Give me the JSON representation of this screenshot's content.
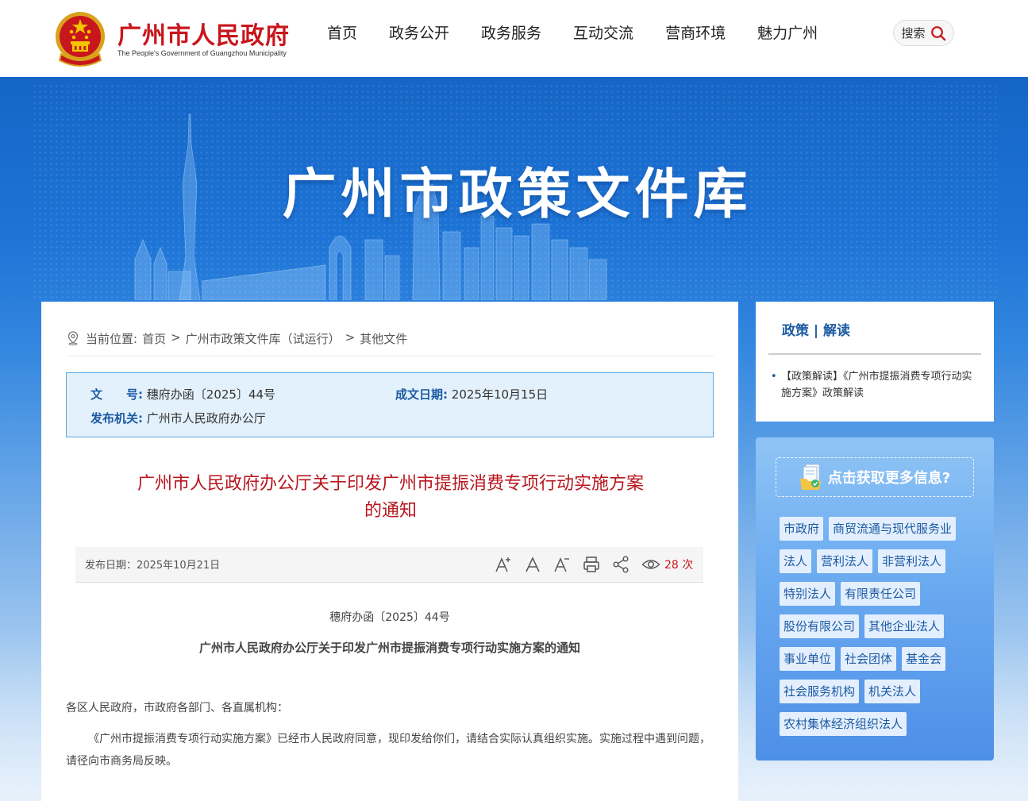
{
  "header": {
    "site_title": "广州市人民政府",
    "site_subtitle": "The People's Government of Guangzhou Municipality",
    "nav": [
      "首页",
      "政务公开",
      "政务服务",
      "互动交流",
      "营商环境",
      "魅力广州"
    ],
    "search_label": "搜索"
  },
  "banner": {
    "title": "广州市政策文件库"
  },
  "breadcrumb": {
    "prefix": "当前位置:",
    "items": [
      "首页",
      "广州市政策文件库（试运行）",
      "其他文件"
    ],
    "separator": ">"
  },
  "meta": {
    "doc_no_label": "文　　号:",
    "doc_no_value": "穗府办函〔2025〕44号",
    "date_label": "成文日期:",
    "date_value": "2025年10月15日",
    "issuer_label": "发布机关:",
    "issuer_value": "广州市人民政府办公厅"
  },
  "document": {
    "title_line1": "广州市人民政府办公厅关于印发广州市提振消费专项行动实施方案",
    "title_line2": "的通知",
    "publish_date": "发布日期：2025年10月21日",
    "views_count": "28",
    "views_unit": "次",
    "doc_number": "穗府办函〔2025〕44号",
    "subtitle": "广州市人民政府办公厅关于印发广州市提振消费专项行动实施方案的通知",
    "salutation": "各区人民政府，市政府各部门、各直属机构：",
    "body": "《广州市提振消费专项行动实施方案》已经市人民政府同意，现印发给你们，请结合实际认真组织实施。实施过程中遇到问题，请径向市商务局反映。"
  },
  "toolbar_icons": [
    "font-increase-icon",
    "font-reset-icon",
    "font-decrease-icon",
    "print-icon",
    "share-icon",
    "eye-icon"
  ],
  "sidebar": {
    "heading": "政策 | 解读",
    "items": [
      "【政策解读】《广州市提振消费专项行动实施方案》政策解读"
    ]
  },
  "tag_panel": {
    "header": "点击获取更多信息?",
    "tags": [
      "市政府",
      "商贸流通与现代服务业",
      "法人",
      "营利法人",
      "非营利法人",
      "特别法人",
      "有限责任公司",
      "股份有限公司",
      "其他企业法人",
      "事业单位",
      "社会团体",
      "基金会",
      "社会服务机构",
      "机关法人",
      "农村集体经济组织法人"
    ]
  },
  "colors": {
    "brand_red": "#c8161d",
    "brand_blue": "#1c5aa2",
    "banner_blue": "#1565c6",
    "meta_bg": "#e3f1fc"
  }
}
